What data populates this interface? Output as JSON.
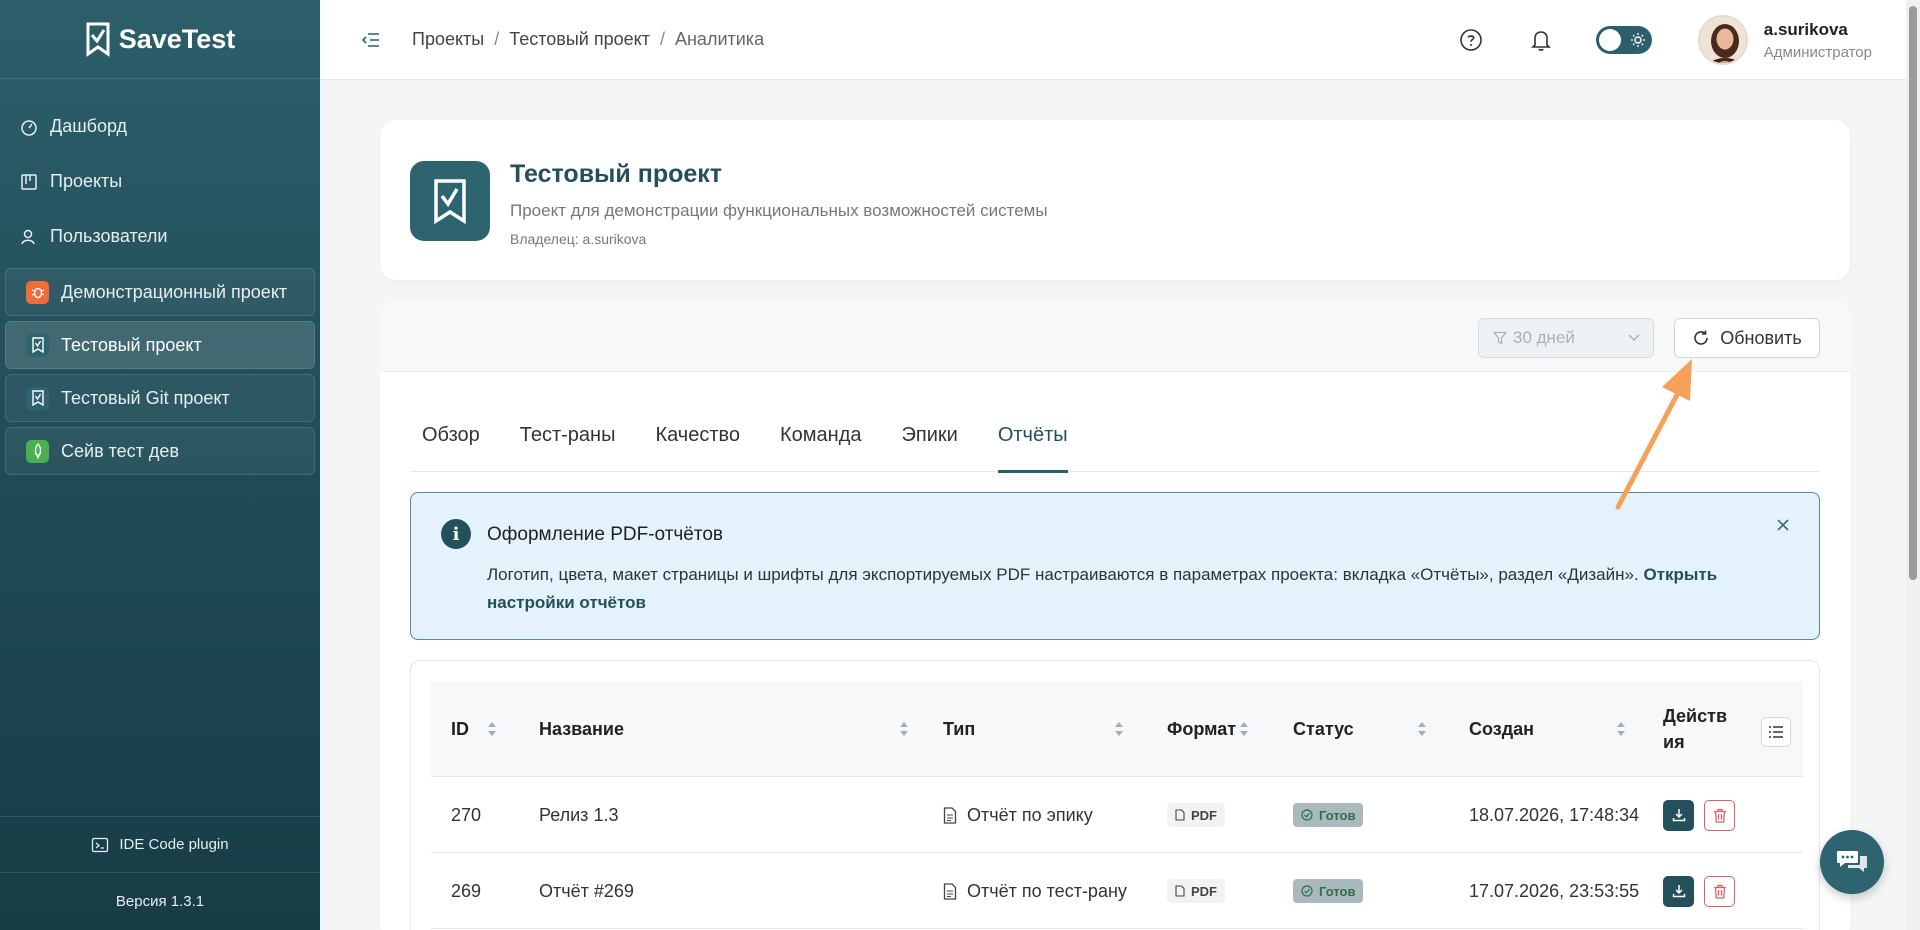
{
  "brand": {
    "name": "SaveTest"
  },
  "sidebar": {
    "nav": [
      {
        "label": "Дашборд",
        "icon": "dashboard-icon"
      },
      {
        "label": "Проекты",
        "icon": "projects-icon"
      },
      {
        "label": "Пользователи",
        "icon": "users-icon"
      }
    ],
    "projects": [
      {
        "label": "Демонстрационный проект",
        "icon": "bug-icon",
        "color": "#f26b3a",
        "active": false
      },
      {
        "label": "Тестовый проект",
        "icon": "savetest-icon",
        "color": "#2e6470",
        "active": true
      },
      {
        "label": "Тестовый Git проект",
        "icon": "savetest-icon",
        "color": "#2e6470",
        "active": false
      },
      {
        "label": "Сейв тест дев",
        "icon": "rocket-icon",
        "color": "#4caf50",
        "active": false
      }
    ],
    "ide_plugin": "IDE Code plugin",
    "version": "Версия 1.3.1"
  },
  "topbar": {
    "breadcrumb": [
      "Проекты",
      "Тестовый проект",
      "Аналитика"
    ],
    "user": {
      "name": "a.surikova",
      "role": "Администратор"
    }
  },
  "project": {
    "title": "Тестовый проект",
    "description": "Проект для демонстрации функциональных возможностей системы",
    "owner": "Владелец: a.surikova"
  },
  "toolbar": {
    "period": "30 дней",
    "refresh": "Обновить"
  },
  "tabs": [
    {
      "label": "Обзор",
      "active": false
    },
    {
      "label": "Тест-раны",
      "active": false
    },
    {
      "label": "Качество",
      "active": false
    },
    {
      "label": "Команда",
      "active": false
    },
    {
      "label": "Эпики",
      "active": false
    },
    {
      "label": "Отчёты",
      "active": true
    }
  ],
  "alert": {
    "title": "Оформление PDF-отчётов",
    "text": "Логотип, цвета, макет страницы и шрифты для экспортируемых PDF настраиваются в параметрах проекта: вкладка «Отчёты», раздел «Дизайн».",
    "link": "Открыть настройки отчётов"
  },
  "table": {
    "columns": [
      "ID",
      "Название",
      "Тип",
      "Формат",
      "Статус",
      "Создан",
      "Действия"
    ],
    "rows": [
      {
        "id": "270",
        "name": "Релиз 1.3",
        "type": "Отчёт по эпику",
        "format": "PDF",
        "status": "Готов",
        "created": "18.07.2026, 17:48:34"
      },
      {
        "id": "269",
        "name": "Отчёт #269",
        "type": "Отчёт по тест-рану",
        "format": "PDF",
        "status": "Готов",
        "created": "17.07.2026, 23:53:55"
      }
    ]
  },
  "colors": {
    "sidebar": "#2c5f6a",
    "accent": "#23505b",
    "arrow": "#f5a15a",
    "danger": "#e06060"
  }
}
